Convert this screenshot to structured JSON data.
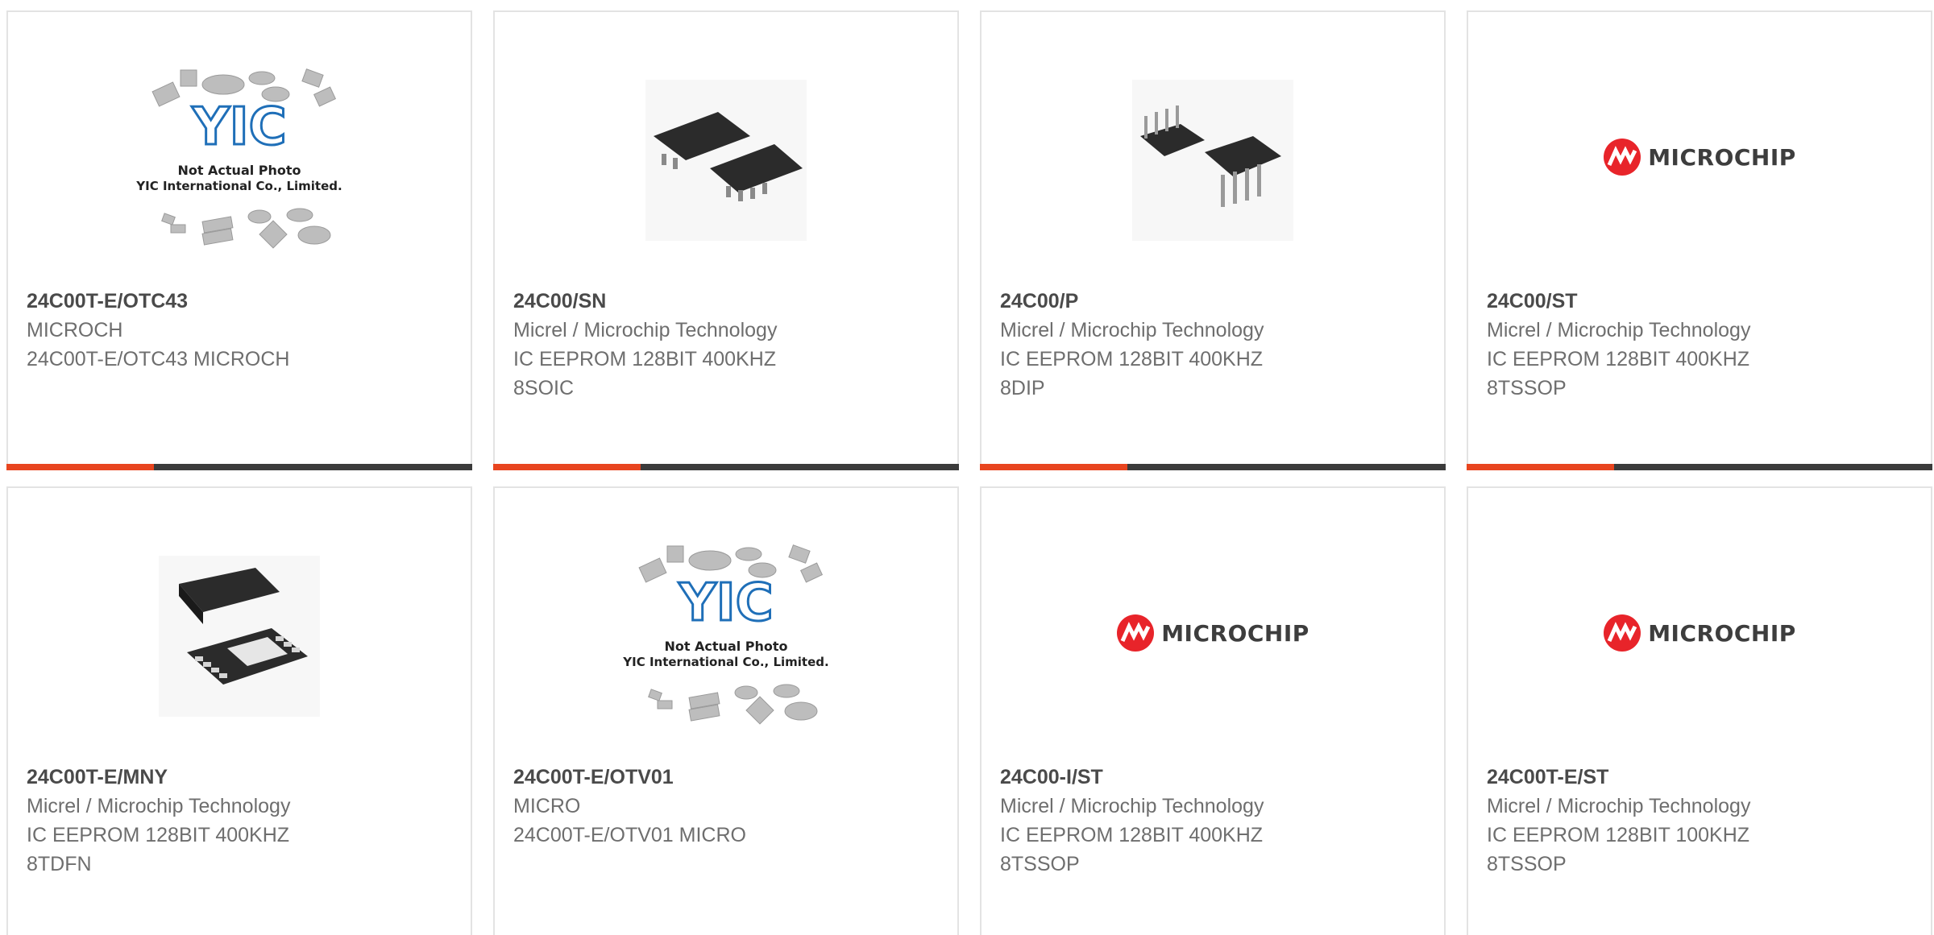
{
  "placeholder": {
    "line1": "Not Actual Photo",
    "line2": "YIC International Co., Limited.",
    "brand": "YIC"
  },
  "logo": {
    "text": "MICROCHIP"
  },
  "colors": {
    "accent": "#e8451f",
    "bar_dark": "#3b3b3b",
    "title": "#4a4a4a",
    "text": "#6e6e6e",
    "border": "#e3e3e3",
    "yic_blue": "#1f6fb8",
    "microchip_red": "#e8242a"
  },
  "products": [
    {
      "part": "24C00T-E/OTC43",
      "manufacturer": "MICROCH",
      "description": "24C00T-E/OTC43 MICROCH",
      "image": "yic-placeholder"
    },
    {
      "part": "24C00/SN",
      "manufacturer": "Micrel / Microchip Technology",
      "description": "IC EEPROM 128BIT 400KHZ\n8SOIC",
      "image": "soic-chip-photo"
    },
    {
      "part": "24C00/P",
      "manufacturer": "Micrel / Microchip Technology",
      "description": "IC EEPROM 128BIT 400KHZ\n8DIP",
      "image": "dip-chip-photo"
    },
    {
      "part": "24C00/ST",
      "manufacturer": "Micrel / Microchip Technology",
      "description": "IC EEPROM 128BIT 400KHZ\n8TSSOP",
      "image": "microchip-logo"
    },
    {
      "part": "24C00T-E/MNY",
      "manufacturer": "Micrel / Microchip Technology",
      "description": "IC EEPROM 128BIT 400KHZ\n8TDFN",
      "image": "tdfn-chip-photo"
    },
    {
      "part": "24C00T-E/OTV01",
      "manufacturer": "MICRO",
      "description": "24C00T-E/OTV01 MICRO",
      "image": "yic-placeholder"
    },
    {
      "part": "24C00-I/ST",
      "manufacturer": "Micrel / Microchip Technology",
      "description": "IC EEPROM 128BIT 400KHZ\n8TSSOP",
      "image": "microchip-logo"
    },
    {
      "part": "24C00T-E/ST",
      "manufacturer": "Micrel / Microchip Technology",
      "description": "IC EEPROM 128BIT 100KHZ\n8TSSOP",
      "image": "microchip-logo"
    }
  ]
}
